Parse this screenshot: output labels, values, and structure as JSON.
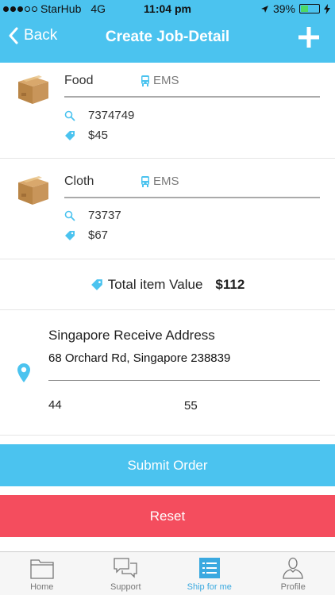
{
  "status_bar": {
    "carrier": "StarHub",
    "network": "4G",
    "time": "11:04 pm",
    "battery": "39%",
    "battery_level": 0.39
  },
  "nav": {
    "back_label": "Back",
    "title": "Create Job-Detail"
  },
  "items": [
    {
      "name": "Food",
      "carrier": "EMS",
      "tracking": "7374749",
      "price": "$45"
    },
    {
      "name": "Cloth",
      "carrier": "EMS",
      "tracking": "73737",
      "price": "$67"
    }
  ],
  "total": {
    "label": "Total item Value",
    "amount": "$112"
  },
  "address": {
    "title": "Singapore Receive Address",
    "line": "68 Orchard Rd, Singapore 238839",
    "field_1": "44",
    "field_2": "55"
  },
  "buttons": {
    "submit": "Submit Order",
    "reset": "Reset"
  },
  "tabs": [
    {
      "label": "Home",
      "icon": "folder-icon"
    },
    {
      "label": "Support",
      "icon": "chat-bubbles-icon"
    },
    {
      "label": "Ship for me",
      "icon": "list-icon",
      "active": true
    },
    {
      "label": "Profile",
      "icon": "person-icon"
    }
  ],
  "colors": {
    "accent": "#4bc3ef",
    "danger": "#f44d5e",
    "tab_active": "#3aa9e0"
  }
}
